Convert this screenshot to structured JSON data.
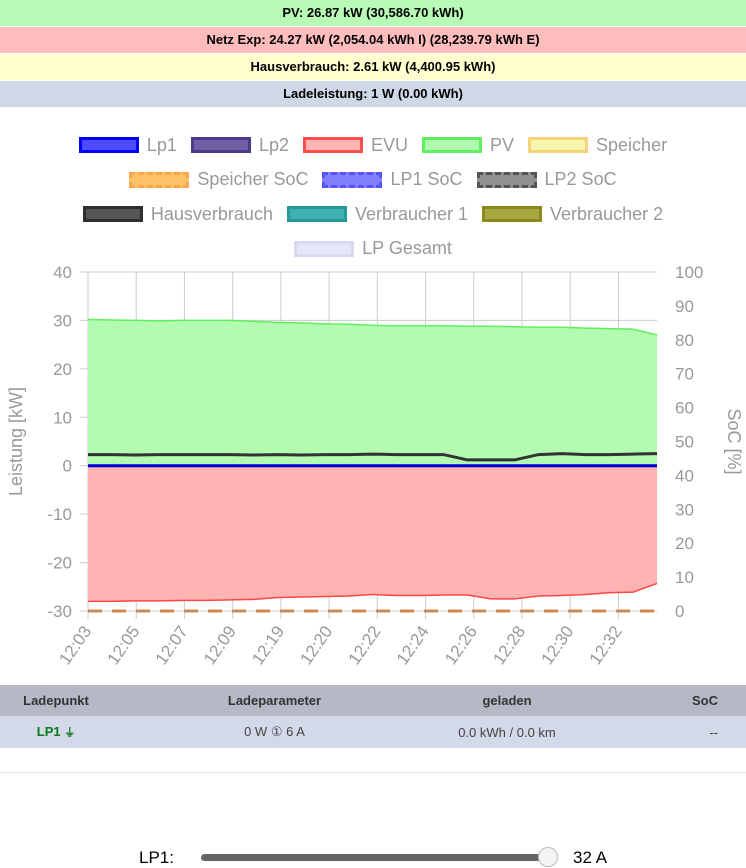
{
  "status": {
    "pv": "PV: 26.87 kW (30,586.70 kWh)",
    "netz": "Netz Exp: 24.27 kW (2,054.04 kWh I) (28,239.79 kWh E)",
    "haus": "Hausverbrauch: 2.61 kW (4,400.95 kWh)",
    "lade": "Ladeleistung: 1 W (0.00 kWh)"
  },
  "colors": {
    "pv_bar": "#b7fbb7",
    "netz_bar": "#ffbcbc",
    "haus_bar": "#fefece",
    "lade_bar": "#d0d7e6"
  },
  "legend": [
    [
      {
        "label": "Lp1",
        "border": "#0000ff",
        "fill": "#4d4dff",
        "dashed": false
      },
      {
        "label": "Lp2",
        "border": "#4b3b8a",
        "fill": "#6e5ea4",
        "dashed": false
      },
      {
        "label": "EVU",
        "border": "#ff4d4d",
        "fill": "#ffb3b3",
        "dashed": false
      },
      {
        "label": "PV",
        "border": "#5ff05f",
        "fill": "#b0fab0",
        "dashed": false
      },
      {
        "label": "Speicher",
        "border": "#f5d27a",
        "fill": "#f5f5b0",
        "dashed": false
      }
    ],
    [
      {
        "label": "Speicher SoC",
        "border": "#ffa64d",
        "fill": "#ffc266",
        "dashed": true
      },
      {
        "label": "LP1 SoC",
        "border": "#5555ff",
        "fill": "#8080ff",
        "dashed": true
      },
      {
        "label": "LP2 SoC",
        "border": "#555555",
        "fill": "#909090",
        "dashed": true
      }
    ],
    [
      {
        "label": "Hausverbrauch",
        "border": "#2e2e2e",
        "fill": "#555555",
        "dashed": false
      },
      {
        "label": "Verbraucher 1",
        "border": "#249a9a",
        "fill": "#40b0b0",
        "dashed": false
      },
      {
        "label": "Verbraucher 2",
        "border": "#8a8a1a",
        "fill": "#a8a840",
        "dashed": false
      }
    ],
    [
      {
        "label": "LP Gesamt",
        "border": "#d8d8f0",
        "fill": "#e6e6fa",
        "dashed": false
      }
    ]
  ],
  "chart_data": {
    "type": "area",
    "x": [
      "12:03",
      "12:05",
      "12:07",
      "12:09",
      "12:19",
      "12:20",
      "12:22",
      "12:24",
      "12:26",
      "12:28",
      "12:30",
      "12:32"
    ],
    "ylabel": "Leistung [kW]",
    "y2label": "SoC [%]",
    "ylim": [
      -30,
      40
    ],
    "y2lim": [
      0,
      100
    ],
    "yticks": [
      "40",
      "30",
      "20",
      "10",
      "0",
      "-10",
      "-20",
      "-30"
    ],
    "y2ticks": [
      "100",
      "90",
      "80",
      "70",
      "60",
      "50",
      "40",
      "30",
      "20",
      "10",
      "0"
    ],
    "series": [
      {
        "name": "PV",
        "values": [
          30.2,
          30.1,
          30.0,
          29.9,
          30.0,
          30.0,
          30.0,
          29.8,
          29.6,
          29.5,
          29.3,
          29.2,
          29.0,
          28.9,
          28.9,
          28.9,
          28.8,
          28.8,
          28.7,
          28.6,
          28.6,
          28.4,
          28.3,
          28.2,
          27.0
        ]
      },
      {
        "name": "EVU",
        "values": [
          -28.0,
          -28.0,
          -27.9,
          -27.9,
          -27.8,
          -27.8,
          -27.7,
          -27.6,
          -27.2,
          -27.1,
          -27.0,
          -26.9,
          -26.6,
          -26.8,
          -26.8,
          -26.7,
          -26.7,
          -27.5,
          -27.5,
          -26.9,
          -26.8,
          -26.6,
          -26.2,
          -26.1,
          -24.3
        ]
      },
      {
        "name": "Hausverbrauch",
        "values": [
          2.3,
          2.3,
          2.2,
          2.3,
          2.3,
          2.3,
          2.3,
          2.2,
          2.3,
          2.2,
          2.3,
          2.3,
          2.4,
          2.3,
          2.3,
          2.3,
          1.2,
          1.2,
          1.2,
          2.3,
          2.5,
          2.3,
          2.3,
          2.4,
          2.5
        ]
      },
      {
        "name": "Lp1",
        "values": [
          0,
          0,
          0,
          0,
          0,
          0,
          0,
          0,
          0,
          0,
          0,
          0,
          0,
          0,
          0,
          0,
          0,
          0,
          0,
          0,
          0,
          0,
          0,
          0,
          0
        ]
      },
      {
        "name": "Speicher SoC",
        "values": [
          0,
          0,
          0,
          0,
          0,
          0,
          0,
          0,
          0,
          0,
          0,
          0,
          0,
          0,
          0,
          0,
          0,
          0,
          0,
          0,
          0,
          0,
          0,
          0,
          0
        ]
      }
    ]
  },
  "table": {
    "headers": [
      "Ladepunkt",
      "Ladeparameter",
      "geladen",
      "SoC"
    ],
    "row": {
      "lp": "LP1",
      "plug_icon": "plug-icon",
      "params": "0 W ① 6 A",
      "geladen": "0.0 kWh / 0.0 km",
      "soc": "--"
    }
  },
  "slider": {
    "label": "LP1:",
    "value_text": "32 A",
    "value": 32,
    "min": 6,
    "max": 32
  }
}
